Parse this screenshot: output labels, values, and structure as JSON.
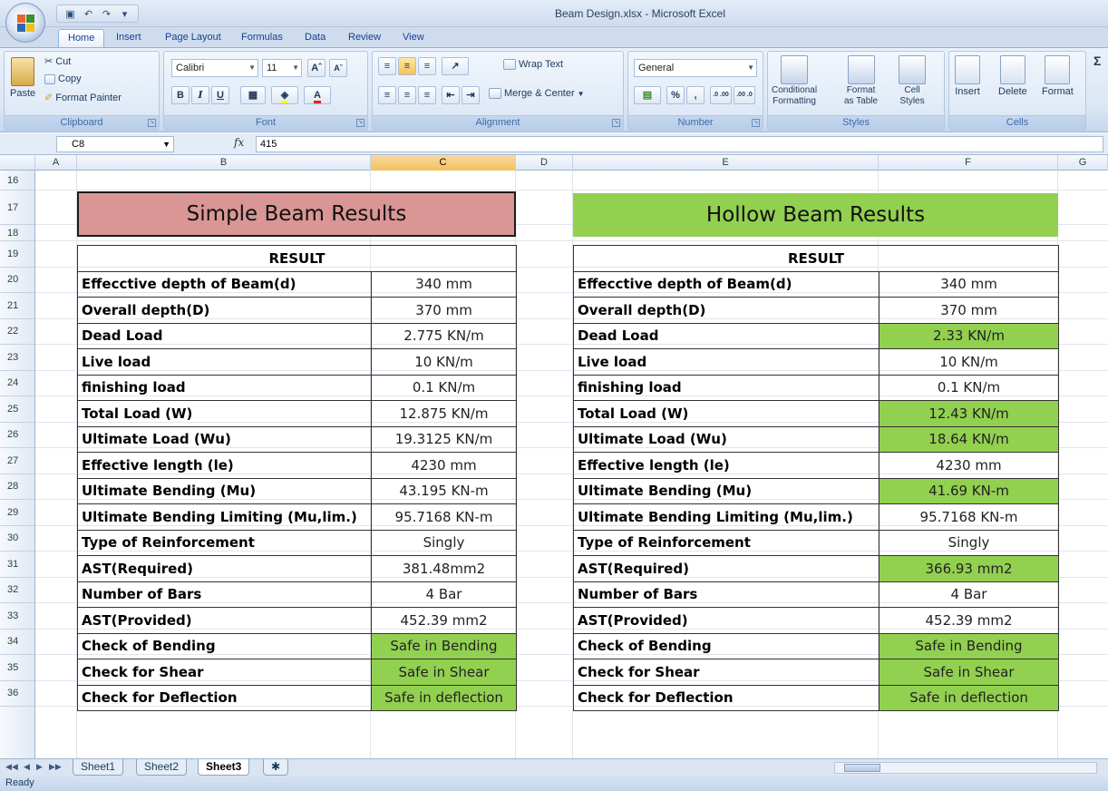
{
  "window": {
    "title": "Beam Design.xlsx - Microsoft Excel"
  },
  "quick_access": {
    "icons": [
      "save-icon",
      "undo-icon",
      "redo-icon",
      "customize-icon"
    ],
    "glyphs": [
      "▣",
      "↶",
      "↷",
      "▾"
    ]
  },
  "tabs": [
    "Home",
    "Insert",
    "Page Layout",
    "Formulas",
    "Data",
    "Review",
    "View"
  ],
  "ribbon": {
    "clipboard": {
      "paste": "Paste",
      "cut": "Cut",
      "copy": "Copy",
      "format_painter": "Format Painter",
      "label": "Clipboard"
    },
    "font": {
      "name": "Calibri",
      "size": "11",
      "grow": "Aˆ",
      "shrink": "Aˇ",
      "bold": "B",
      "italic": "I",
      "underline": "U",
      "label": "Font"
    },
    "alignment": {
      "wrap_text": "Wrap Text",
      "merge_center": "Merge & Center",
      "label": "Alignment"
    },
    "number": {
      "format": "General",
      "percent": "%",
      "comma": ",",
      "inc_decimal": ".0 .00",
      "dec_decimal": ".00 .0",
      "label": "Number"
    },
    "styles": {
      "conditional": "Conditional",
      "conditional2": "Formatting",
      "format_table": "Format",
      "format_table2": "as Table",
      "cell_styles": "Cell",
      "cell_styles2": "Styles",
      "label": "Styles"
    },
    "cells": {
      "insert": "Insert",
      "delete": "Delete",
      "format": "Format",
      "label": "Cells"
    }
  },
  "formula_bar": {
    "name_box": "C8",
    "fx": "fx",
    "value": "415"
  },
  "columns": [
    "A",
    "B",
    "C",
    "D",
    "E",
    "F",
    "G"
  ],
  "selected_column": "C",
  "rows": [
    "16",
    "17",
    "18",
    "19",
    "20",
    "21",
    "22",
    "23",
    "24",
    "25",
    "26",
    "27",
    "28",
    "29",
    "30",
    "31",
    "32",
    "33",
    "34",
    "35",
    "36"
  ],
  "simple": {
    "banner": "Simple Beam Results",
    "header": "RESULT",
    "rows": [
      {
        "label": "Effecctive depth of Beam(d)",
        "value": "340 mm",
        "green": false
      },
      {
        "label": "Overall depth(D)",
        "value": "370 mm",
        "green": false
      },
      {
        "label": "Dead Load",
        "value": "2.775 KN/m",
        "green": false
      },
      {
        "label": "Live load",
        "value": "10 KN/m",
        "green": false
      },
      {
        "label": "finishing load",
        "value": "0.1 KN/m",
        "green": false
      },
      {
        "label": "Total Load (W)",
        "value": "12.875 KN/m",
        "green": false
      },
      {
        "label": "Ultimate Load (Wu)",
        "value": "19.3125 KN/m",
        "green": false
      },
      {
        "label": "Effective length (le)",
        "value": "4230 mm",
        "green": false
      },
      {
        "label": "Ultimate Bending (Mu)",
        "value": "43.195 KN-m",
        "green": false
      },
      {
        "label": "Ultimate Bending Limiting (Mu,lim.)",
        "value": "95.7168 KN-m",
        "green": false
      },
      {
        "label": "Type of Reinforcement",
        "value": "Singly",
        "green": false
      },
      {
        "label": "AST(Required)",
        "value": "381.48mm2",
        "green": false
      },
      {
        "label": "Number of Bars",
        "value": "4 Bar",
        "green": false
      },
      {
        "label": "AST(Provided)",
        "value": "452.39 mm2",
        "green": false
      },
      {
        "label": "Check of Bending",
        "value": "Safe in Bending",
        "green": true
      },
      {
        "label": "Check for Shear",
        "value": "Safe in Shear",
        "green": true
      },
      {
        "label": "Check for Deflection",
        "value": "Safe in deflection",
        "green": true
      }
    ]
  },
  "hollow": {
    "banner": "Hollow Beam Results",
    "header": "RESULT",
    "rows": [
      {
        "label": "Effecctive depth of Beam(d)",
        "value": "340 mm",
        "green": false
      },
      {
        "label": "Overall depth(D)",
        "value": "370 mm",
        "green": false
      },
      {
        "label": "Dead Load",
        "value": "2.33 KN/m",
        "green": true
      },
      {
        "label": "Live load",
        "value": "10 KN/m",
        "green": false
      },
      {
        "label": "finishing load",
        "value": "0.1 KN/m",
        "green": false
      },
      {
        "label": "Total Load (W)",
        "value": "12.43 KN/m",
        "green": true
      },
      {
        "label": "Ultimate Load (Wu)",
        "value": "18.64 KN/m",
        "green": true
      },
      {
        "label": "Effective length (le)",
        "value": "4230 mm",
        "green": false
      },
      {
        "label": "Ultimate Bending (Mu)",
        "value": "41.69 KN-m",
        "green": true
      },
      {
        "label": "Ultimate Bending Limiting (Mu,lim.)",
        "value": "95.7168 KN-m",
        "green": false
      },
      {
        "label": "Type of Reinforcement",
        "value": "Singly",
        "green": false
      },
      {
        "label": "AST(Required)",
        "value": "366.93 mm2",
        "green": true
      },
      {
        "label": "Number of Bars",
        "value": "4 Bar",
        "green": false
      },
      {
        "label": "AST(Provided)",
        "value": "452.39 mm2",
        "green": false
      },
      {
        "label": "Check of Bending",
        "value": "Safe in Bending",
        "green": true
      },
      {
        "label": "Check for Shear",
        "value": "Safe in Shear",
        "green": true
      },
      {
        "label": "Check for Deflection",
        "value": "Safe in deflection",
        "green": true
      }
    ]
  },
  "sheets": [
    "Sheet1",
    "Sheet2",
    "Sheet3"
  ],
  "active_sheet": "Sheet3",
  "status": "Ready",
  "colors": {
    "simple_banner": "#d99694",
    "hollow_banner": "#92d050",
    "green_cell": "#92d050",
    "selected_header": "#f1c15f"
  }
}
